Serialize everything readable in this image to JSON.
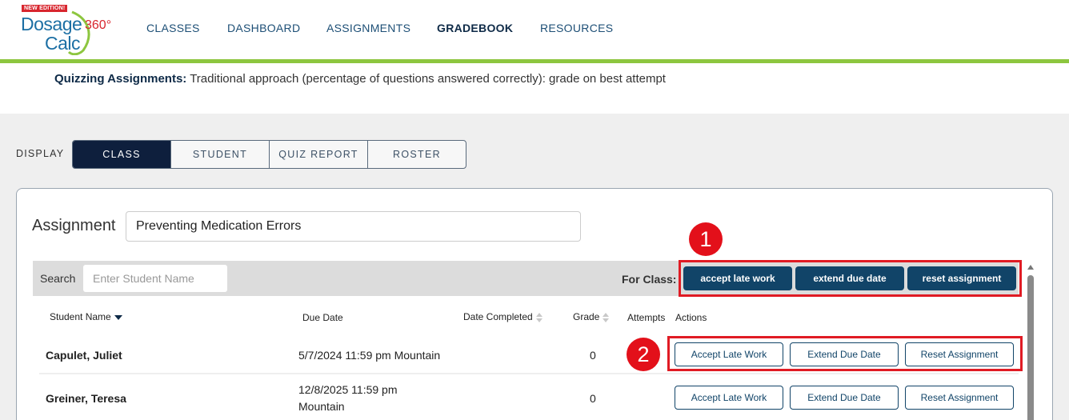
{
  "logo": {
    "badge": "NEW EDITION!",
    "line1": "Dosage",
    "line2": "Calc",
    "suffix": "360°"
  },
  "nav": {
    "items": [
      {
        "label": "CLASSES",
        "active": false
      },
      {
        "label": "DASHBOARD",
        "active": false
      },
      {
        "label": "ASSIGNMENTS",
        "active": false
      },
      {
        "label": "GRADEBOOK",
        "active": true
      },
      {
        "label": "RESOURCES",
        "active": false
      }
    ]
  },
  "info": {
    "label": "Quizzing Assignments:",
    "text": " Traditional approach (percentage of questions answered correctly): grade on best attempt"
  },
  "display": {
    "label": "DISPLAY",
    "tabs": [
      {
        "label": "CLASS",
        "active": true
      },
      {
        "label": "STUDENT",
        "active": false
      },
      {
        "label": "QUIZ REPORT",
        "active": false
      },
      {
        "label": "ROSTER",
        "active": false
      }
    ]
  },
  "assignment": {
    "label": "Assignment",
    "value": "Preventing Medication Errors"
  },
  "filter": {
    "search_label": "Search",
    "search_placeholder": "Enter Student Name",
    "for_class_label": "For Class:",
    "class_buttons": [
      "accept late work",
      "extend due date",
      "reset assignment"
    ]
  },
  "markers": {
    "one": "1",
    "two": "2"
  },
  "table": {
    "columns": [
      "Student Name",
      "Due Date",
      "Date Completed",
      "Grade",
      "Attempts",
      "Actions"
    ],
    "rows": [
      {
        "name": "Capulet, Juliet",
        "due_line1": "5/7/2024 11:59 pm Mountain",
        "due_line2": "",
        "completed": "",
        "grade": "0",
        "attempts": "",
        "actions": [
          "Accept Late Work",
          "Extend Due Date",
          "Reset Assignment"
        ]
      },
      {
        "name": "Greiner, Teresa",
        "due_line1": "12/8/2025 11:59 pm",
        "due_line2": "Mountain",
        "completed": "",
        "grade": "0",
        "attempts": "",
        "actions": [
          "Accept Late Work",
          "Extend Due Date",
          "Reset Assignment"
        ]
      }
    ]
  },
  "colors": {
    "primary_dark": "#0e1f3d",
    "button_blue": "#114468",
    "accent_green": "#8dc63f",
    "highlight_red": "#e01b24"
  }
}
